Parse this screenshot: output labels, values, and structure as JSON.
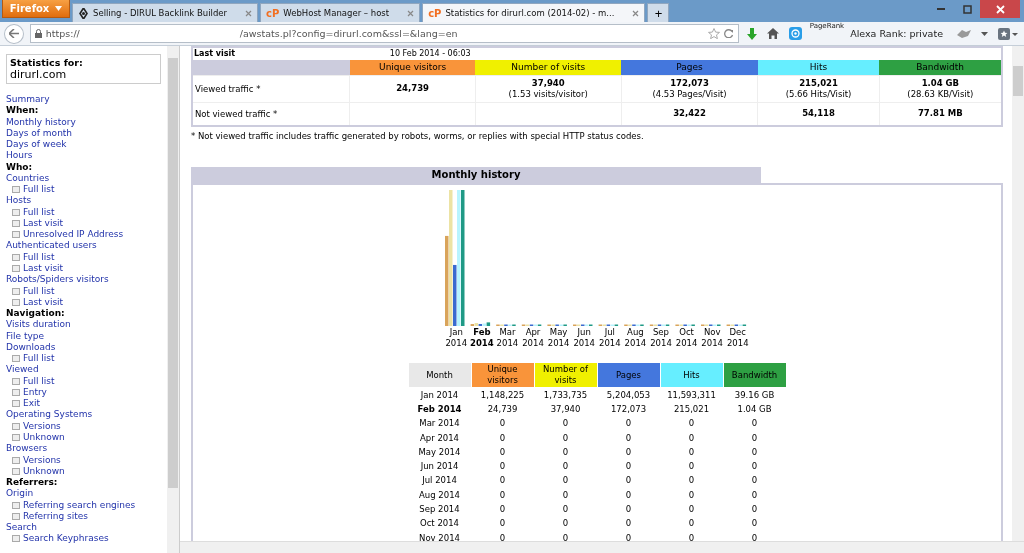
{
  "browser": {
    "menu_button": "Firefox",
    "tabs": [
      {
        "title": "Selling - DIRUL Backlink Builder",
        "selected": false
      },
      {
        "logo": "cP",
        "title": "WebHost Manager – host",
        "selected": false
      },
      {
        "logo": "cP",
        "title": "Statistics for dirurl.com (2014-02) - m...",
        "selected": true
      }
    ],
    "new_tab": "+",
    "url_scheme": "https://",
    "url_path": "/awstats.pl?config=dirurl.com&ssl=&lang=en",
    "pagerank": "PageRank",
    "alexa": "Alexa Rank: private"
  },
  "sidebar": {
    "stats_label": "Statistics for:",
    "site": "dirurl.com",
    "items": [
      {
        "kind": "link",
        "label": "Summary"
      },
      {
        "kind": "heading",
        "label": "When:"
      },
      {
        "kind": "link",
        "label": "Monthly history"
      },
      {
        "kind": "link",
        "label": "Days of month"
      },
      {
        "kind": "link",
        "label": "Days of week"
      },
      {
        "kind": "link",
        "label": "Hours"
      },
      {
        "kind": "heading",
        "label": "Who:"
      },
      {
        "kind": "link",
        "label": "Countries"
      },
      {
        "kind": "sub",
        "label": "Full list"
      },
      {
        "kind": "link",
        "label": "Hosts"
      },
      {
        "kind": "sub",
        "label": "Full list"
      },
      {
        "kind": "sub",
        "label": "Last visit"
      },
      {
        "kind": "sub",
        "label": "Unresolved IP Address"
      },
      {
        "kind": "link",
        "label": "Authenticated users"
      },
      {
        "kind": "sub",
        "label": "Full list"
      },
      {
        "kind": "sub",
        "label": "Last visit"
      },
      {
        "kind": "link",
        "label": "Robots/Spiders visitors"
      },
      {
        "kind": "sub",
        "label": "Full list"
      },
      {
        "kind": "sub",
        "label": "Last visit"
      },
      {
        "kind": "heading",
        "label": "Navigation:"
      },
      {
        "kind": "link",
        "label": "Visits duration"
      },
      {
        "kind": "link",
        "label": "File type"
      },
      {
        "kind": "link",
        "label": "Downloads"
      },
      {
        "kind": "sub",
        "label": "Full list"
      },
      {
        "kind": "link",
        "label": "Viewed"
      },
      {
        "kind": "sub",
        "label": "Full list"
      },
      {
        "kind": "sub",
        "label": "Entry"
      },
      {
        "kind": "sub",
        "label": "Exit"
      },
      {
        "kind": "link",
        "label": "Operating Systems"
      },
      {
        "kind": "sub",
        "label": "Versions"
      },
      {
        "kind": "sub",
        "label": "Unknown"
      },
      {
        "kind": "link",
        "label": "Browsers"
      },
      {
        "kind": "sub",
        "label": "Versions"
      },
      {
        "kind": "sub",
        "label": "Unknown"
      },
      {
        "kind": "heading",
        "label": "Referrers:"
      },
      {
        "kind": "link",
        "label": "Origin"
      },
      {
        "kind": "sub",
        "label": "Referring search engines"
      },
      {
        "kind": "sub",
        "label": "Referring sites"
      },
      {
        "kind": "link",
        "label": "Search"
      },
      {
        "kind": "sub",
        "label": "Search Keyphrases"
      }
    ]
  },
  "summary": {
    "last_visit_label": "Last visit",
    "last_visit_value": "10 Feb 2014 - 06:03",
    "columns": [
      {
        "label": "Unique visitors",
        "color": "#f9943a"
      },
      {
        "label": "Number of visits",
        "color": "#f0f000"
      },
      {
        "label": "Pages",
        "color": "#4477dd"
      },
      {
        "label": "Hits",
        "color": "#66eeff"
      },
      {
        "label": "Bandwidth",
        "color": "#2ea043"
      }
    ],
    "rows": [
      {
        "label": "Viewed traffic *",
        "cells": [
          {
            "value": "24,739"
          },
          {
            "value": "37,940",
            "note": "(1.53 visits/visitor)"
          },
          {
            "value": "172,073",
            "note": "(4.53 Pages/Visit)"
          },
          {
            "value": "215,021",
            "note": "(5.66 Hits/Visit)"
          },
          {
            "value": "1.04 GB",
            "note": "(28.63 KB/Visit)"
          }
        ]
      },
      {
        "label": "Not viewed traffic *",
        "cells": [
          {},
          {},
          {
            "value": "32,422"
          },
          {
            "value": "54,118"
          },
          {
            "value": "77.81 MB"
          }
        ]
      }
    ],
    "footnote": "* Not viewed traffic includes traffic generated by robots, worms, or replies with special HTTP status codes."
  },
  "monthly": {
    "title": "Monthly history",
    "month_header": "Month",
    "columns": [
      {
        "label": "Unique visitors",
        "color": "#f9943a"
      },
      {
        "label": "Number of visits",
        "color": "#f0f000"
      },
      {
        "label": "Pages",
        "color": "#4477dd"
      },
      {
        "label": "Hits",
        "color": "#66eeff"
      },
      {
        "label": "Bandwidth",
        "color": "#2ea043"
      }
    ],
    "chart_months": [
      {
        "month": "Jan",
        "year": "2014",
        "current": false
      },
      {
        "month": "Feb",
        "year": "2014",
        "current": true
      },
      {
        "month": "Mar",
        "year": "2014",
        "current": false
      },
      {
        "month": "Apr",
        "year": "2014",
        "current": false
      },
      {
        "month": "May",
        "year": "2014",
        "current": false
      },
      {
        "month": "Jun",
        "year": "2014",
        "current": false
      },
      {
        "month": "Jul",
        "year": "2014",
        "current": false
      },
      {
        "month": "Aug",
        "year": "2014",
        "current": false
      },
      {
        "month": "Sep",
        "year": "2014",
        "current": false
      },
      {
        "month": "Oct",
        "year": "2014",
        "current": false
      },
      {
        "month": "Nov",
        "year": "2014",
        "current": false
      },
      {
        "month": "Dec",
        "year": "2014",
        "current": false
      }
    ],
    "rows": [
      {
        "month": "Jan 2014",
        "current": false,
        "values": [
          "1,148,225",
          "1,733,735",
          "5,204,053",
          "11,593,311",
          "39.16 GB"
        ]
      },
      {
        "month": "Feb 2014",
        "current": true,
        "values": [
          "24,739",
          "37,940",
          "172,073",
          "215,021",
          "1.04 GB"
        ]
      },
      {
        "month": "Mar 2014",
        "current": false,
        "values": [
          "0",
          "0",
          "0",
          "0",
          "0"
        ]
      },
      {
        "month": "Apr 2014",
        "current": false,
        "values": [
          "0",
          "0",
          "0",
          "0",
          "0"
        ]
      },
      {
        "month": "May 2014",
        "current": false,
        "values": [
          "0",
          "0",
          "0",
          "0",
          "0"
        ]
      },
      {
        "month": "Jun 2014",
        "current": false,
        "values": [
          "0",
          "0",
          "0",
          "0",
          "0"
        ]
      },
      {
        "month": "Jul 2014",
        "current": false,
        "values": [
          "0",
          "0",
          "0",
          "0",
          "0"
        ]
      },
      {
        "month": "Aug 2014",
        "current": false,
        "values": [
          "0",
          "0",
          "0",
          "0",
          "0"
        ]
      },
      {
        "month": "Sep 2014",
        "current": false,
        "values": [
          "0",
          "0",
          "0",
          "0",
          "0"
        ]
      },
      {
        "month": "Oct 2014",
        "current": false,
        "values": [
          "0",
          "0",
          "0",
          "0",
          "0"
        ]
      },
      {
        "month": "Nov 2014",
        "current": false,
        "values": [
          "0",
          "0",
          "0",
          "0",
          "0"
        ]
      }
    ]
  }
}
